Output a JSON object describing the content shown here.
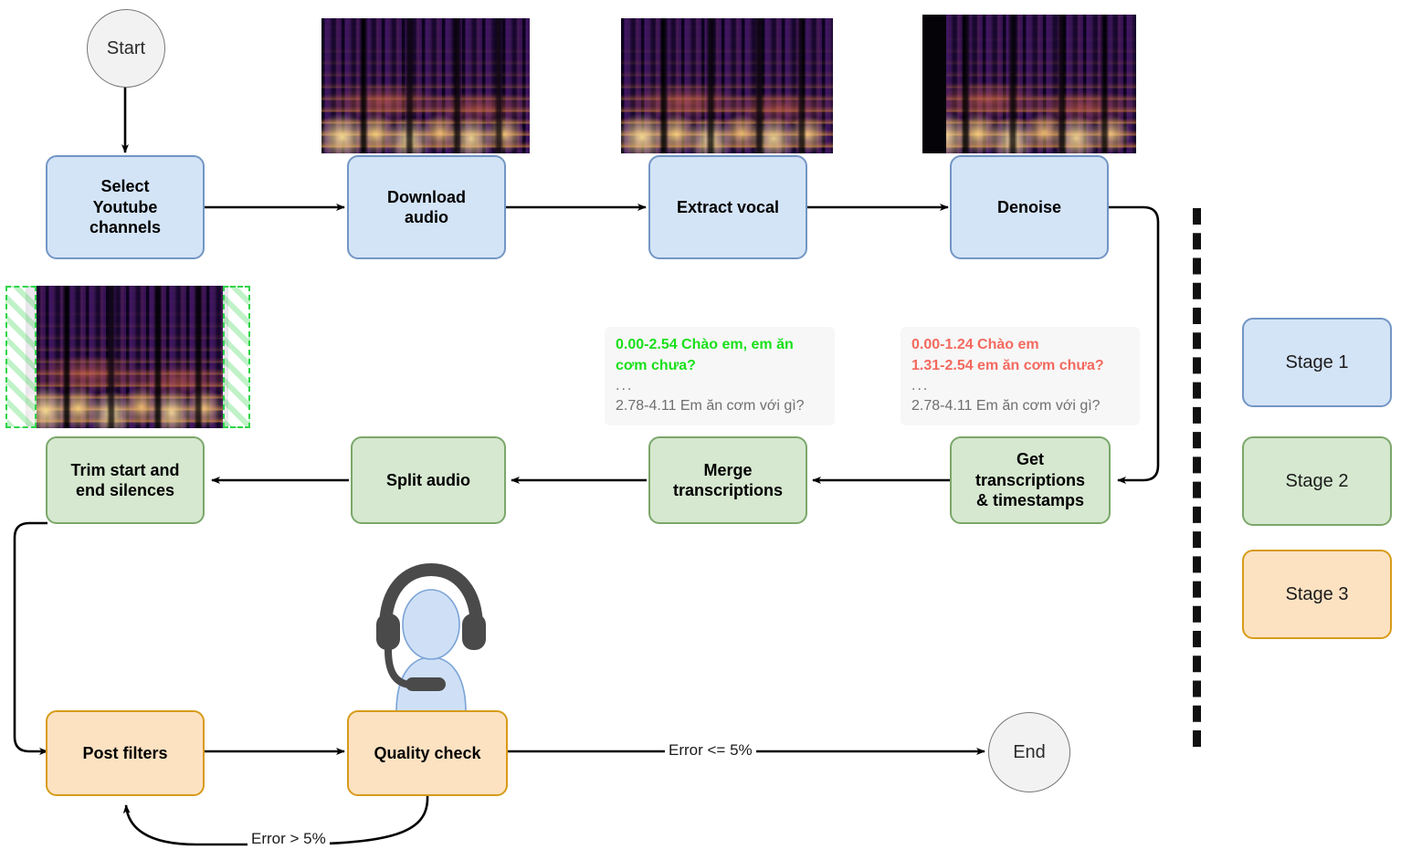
{
  "nodes": {
    "start": "Start",
    "end": "End",
    "select_channels": "Select\nYoutube\nchannels",
    "download_audio": "Download\naudio",
    "extract_vocal": "Extract vocal",
    "denoise": "Denoise",
    "get_transcriptions": "Get\ntranscriptions\n& timestamps",
    "merge_transcriptions": "Merge\ntranscriptions",
    "split_audio": "Split audio",
    "trim_silences": "Trim start and\nend silences",
    "post_filters": "Post filters",
    "quality_check": "Quality check"
  },
  "edge_labels": {
    "error_pass": "Error <= 5%",
    "error_fail": "Error > 5%"
  },
  "transcripts": {
    "merged": {
      "highlight_line1": "0.00-2.54 Chào em, em ăn",
      "highlight_line2": "cơm chưa?",
      "ellipsis": "...",
      "tail": "2.78-4.11 Em ăn cơm với gì?"
    },
    "raw": {
      "highlight_line1": "0.00-1.24 Chào em",
      "highlight_line2": "1.31-2.54 em ăn cơm chưa?",
      "ellipsis": "...",
      "tail": "2.78-4.11 Em ăn cơm với gì?"
    }
  },
  "legend": {
    "stage1": "Stage 1",
    "stage2": "Stage 2",
    "stage3": "Stage 3"
  },
  "colors": {
    "stage1_fill": "#d4e4f7",
    "stage1_stroke": "#7296c4",
    "stage2_fill": "#d6e8d0",
    "stage2_stroke": "#7ba76a",
    "stage3_fill": "#fde2c2",
    "stage3_stroke": "#d79b19",
    "terminal_fill": "#f2f2f2",
    "terminal_stroke": "#777777",
    "transcript_green": "#19e019",
    "transcript_red": "#f4695f",
    "trim_hatch": "#2fd44a",
    "edge": "#000000"
  },
  "icons": {
    "agent": "headset-agent-icon",
    "spectrogram": "spectrogram-image"
  }
}
